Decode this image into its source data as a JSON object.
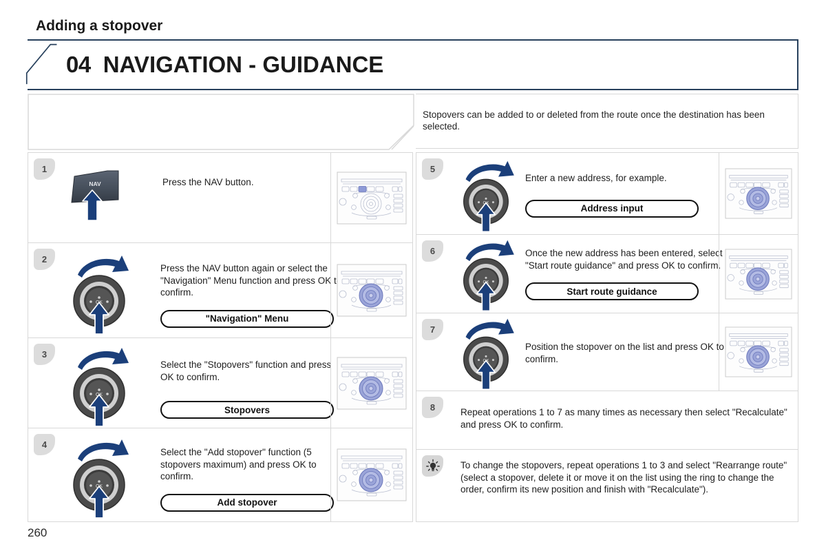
{
  "header": {
    "chapter_number": "04",
    "chapter_title": "NAVIGATION - GUIDANCE",
    "border_color": "#27405c"
  },
  "section": {
    "title": "Adding a stopover",
    "intro": "Stopovers can be added to or deleted from the route once the destination has been selected."
  },
  "left_column": [
    {
      "number": "1",
      "text": "Press the NAV button.",
      "chip": "",
      "illustration": "nav-button",
      "button_label": "NAV",
      "thumbnail": "console-nav-highlight"
    },
    {
      "number": "2",
      "text": "Press the NAV button again or select the \"Navigation\" Menu function and press OK to confirm.",
      "chip": "\"Navigation\" Menu",
      "illustration": "rotary-knob",
      "thumbnail": "console-knob-highlight"
    },
    {
      "number": "3",
      "text": "Select the \"Stopovers\" function and press OK to confirm.",
      "chip": "Stopovers",
      "illustration": "rotary-knob",
      "thumbnail": "console-knob-highlight"
    },
    {
      "number": "4",
      "text": "Select the \"Add stopover\" function (5 stopovers maximum) and press OK to confirm.",
      "chip": "Add stopover",
      "illustration": "rotary-knob",
      "thumbnail": "console-knob-highlight"
    }
  ],
  "right_column": [
    {
      "number": "5",
      "text": "Enter a new address, for example.",
      "chip": "Address input",
      "illustration": "rotary-knob",
      "thumbnail": "console-knob-highlight"
    },
    {
      "number": "6",
      "text": "Once the new address has been entered, select \"Start route guidance\" and press OK to confirm.",
      "chip": "Start route guidance",
      "illustration": "rotary-knob",
      "thumbnail": "console-knob-highlight"
    },
    {
      "number": "7",
      "text": "Position the stopover on the list and press OK to confirm.",
      "chip": "",
      "illustration": "rotary-knob",
      "thumbnail": "console-knob-highlight"
    },
    {
      "number": "8",
      "text": "Repeat operations 1 to 7 as many times as necessary then select \"Recalculate\" and press OK to confirm.",
      "chip": "",
      "illustration": "",
      "thumbnail": ""
    }
  ],
  "tip": {
    "icon": "lightbulb-icon",
    "text": "To change the stopovers, repeat operations 1 to 3 and select \"Rearrange route\" (select a stopover, delete it or move it on the list using the ring to change the order, confirm its new position and finish with \"Recalculate\")."
  },
  "knob": {
    "ok_label": "OK"
  },
  "footer": {
    "page_number": "260"
  },
  "colors": {
    "header_border": "#27405c",
    "arrow_blue": "#1b3f7a",
    "console_highlight": "#8e9ad6",
    "badge_gray": "#dcdcdc",
    "rule_gray": "#d8d8d8"
  }
}
